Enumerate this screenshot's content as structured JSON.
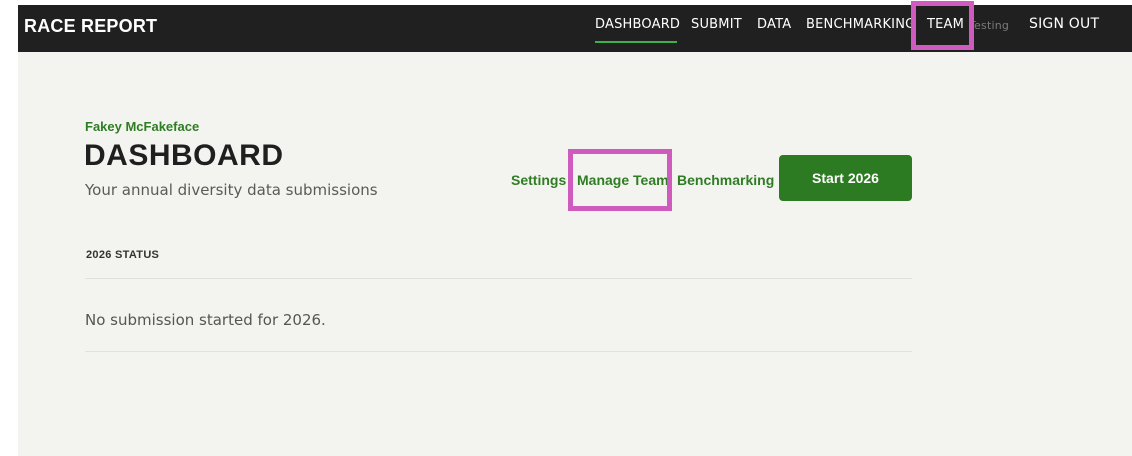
{
  "header": {
    "brand": "RACE REPORT",
    "nav": {
      "dashboard": "DASHBOARD",
      "submit": "SUBMIT",
      "data": "DATA",
      "benchmarking": "BENCHMARKING",
      "team": "TEAM",
      "testing": "Testing",
      "sign_out": "SIGN OUT"
    },
    "active_item": "DASHBOARD"
  },
  "page": {
    "org_name": "Fakey McFakeface",
    "title": "DASHBOARD",
    "subtitle": "Your annual diversity data submissions",
    "actions": {
      "settings": "Settings",
      "manage_team": "Manage Team",
      "benchmarking": "Benchmarking",
      "start_button": "Start 2026"
    }
  },
  "status": {
    "label": "2026 STATUS",
    "message": "No submission started for 2026."
  },
  "colors": {
    "header_bg": "#202020",
    "page_bg": "#f3f4ef",
    "accent_green": "#2f7d24",
    "button_green": "#2c7a22",
    "nav_underline": "#3cb04a",
    "highlight_box": "#d05bbe"
  }
}
